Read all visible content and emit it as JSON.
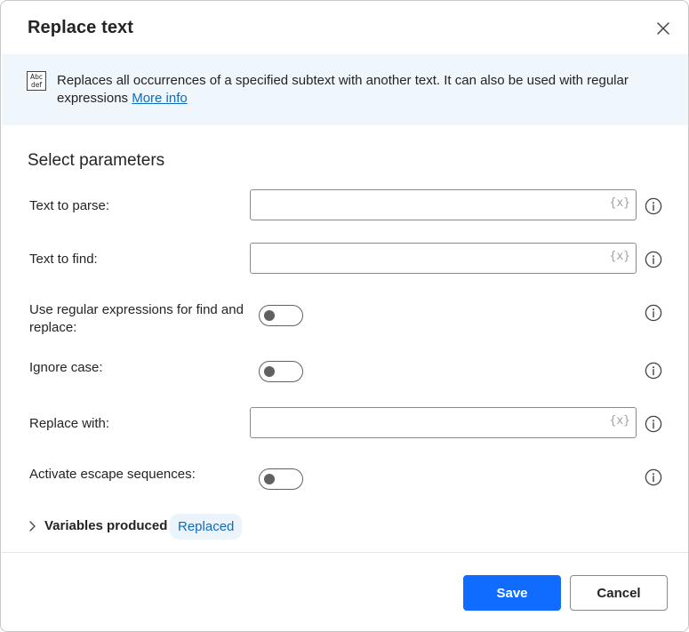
{
  "dialog": {
    "title": "Replace text",
    "close_icon": "close-icon"
  },
  "banner": {
    "icon": "text-abc-icon",
    "icon_lines": [
      "Abc",
      "def"
    ],
    "description": "Replaces all occurrences of a specified subtext with another text. It can also be used with regular expressions",
    "link_label": "More info"
  },
  "parameters": {
    "section_title": "Select parameters",
    "text_to_parse": {
      "label": "Text to parse:",
      "value": "",
      "var_icon": "{x}"
    },
    "text_to_find": {
      "label": "Text to find:",
      "value": "",
      "var_icon": "{x}"
    },
    "use_regex": {
      "label": "Use regular expressions for find and replace:",
      "checked": false
    },
    "ignore_case": {
      "label": "Ignore case:",
      "checked": false
    },
    "replace_with": {
      "label": "Replace with:",
      "value": "",
      "var_icon": "{x}"
    },
    "escape_sequences": {
      "label": "Activate escape sequences:",
      "checked": false
    }
  },
  "variables": {
    "label": "Variables produced",
    "badge": "Replaced"
  },
  "footer": {
    "save_label": "Save",
    "cancel_label": "Cancel"
  },
  "colors": {
    "accent": "#0f6cff",
    "link": "#0f6cbd",
    "banner_bg": "#eff6fc",
    "badge_bg": "#ebf3fc"
  }
}
